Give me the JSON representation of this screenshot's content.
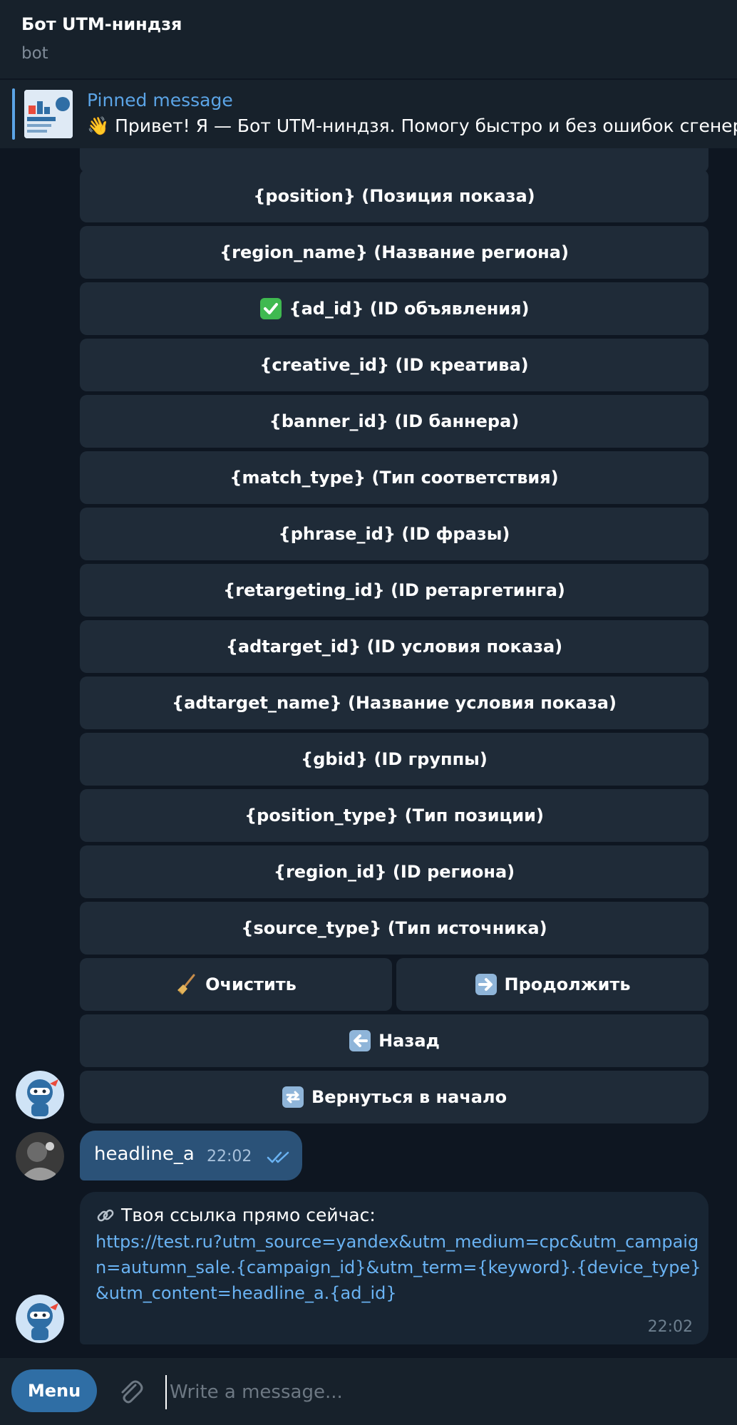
{
  "header": {
    "title": "Бот UTM-ниндзя",
    "subtitle": "bot"
  },
  "pinned": {
    "title": "Pinned message",
    "text": "👋 Привет! Я — Бот UTM-ниндзя. Помогу быстро и без ошибок сгенерировать"
  },
  "keyboard": {
    "buttons": [
      {
        "label": "{position} (Позиция показа)"
      },
      {
        "label": "{region_name} (Название региона)"
      },
      {
        "label": "{ad_id} (ID объявления)",
        "checked": true
      },
      {
        "label": "{creative_id} (ID креатива)"
      },
      {
        "label": "{banner_id} (ID баннера)"
      },
      {
        "label": "{match_type} (Тип соответствия)"
      },
      {
        "label": "{phrase_id} (ID фразы)"
      },
      {
        "label": "{retargeting_id} (ID ретаргетинга)"
      },
      {
        "label": "{adtarget_id} (ID условия показа)"
      },
      {
        "label": "{adtarget_name} (Название условия показа)"
      },
      {
        "label": "{gbid} (ID группы)"
      },
      {
        "label": "{position_type} (Тип позиции)"
      },
      {
        "label": "{region_id} (ID региона)"
      },
      {
        "label": "{source_type} (Тип источника)"
      }
    ],
    "clear_label": "Очистить",
    "continue_label": "Продолжить",
    "back_label": "Назад",
    "restart_label": "Вернуться в начало"
  },
  "messages": {
    "outgoing": {
      "text": "headline_a",
      "time": "22:02"
    },
    "incoming": {
      "intro": "Твоя ссылка прямо сейчас:",
      "link": "https://test.ru?utm_source=yandex&utm_medium=cpc&utm_campaign=autumn_sale.{campaign_id}&utm_term={keyword}.{device_type}&utm_content=headline_a.{ad_id}",
      "time": "22:02"
    }
  },
  "composer": {
    "menu_label": "Menu",
    "placeholder": "Write a message..."
  },
  "colors": {
    "background": "#0e1621",
    "panel": "#17212b",
    "keyboard_button": "#1f2b38",
    "outgoing_bubble": "#2b5278",
    "incoming_bubble": "#182533",
    "link": "#6ab3f3",
    "accent": "#5ba4e6"
  }
}
